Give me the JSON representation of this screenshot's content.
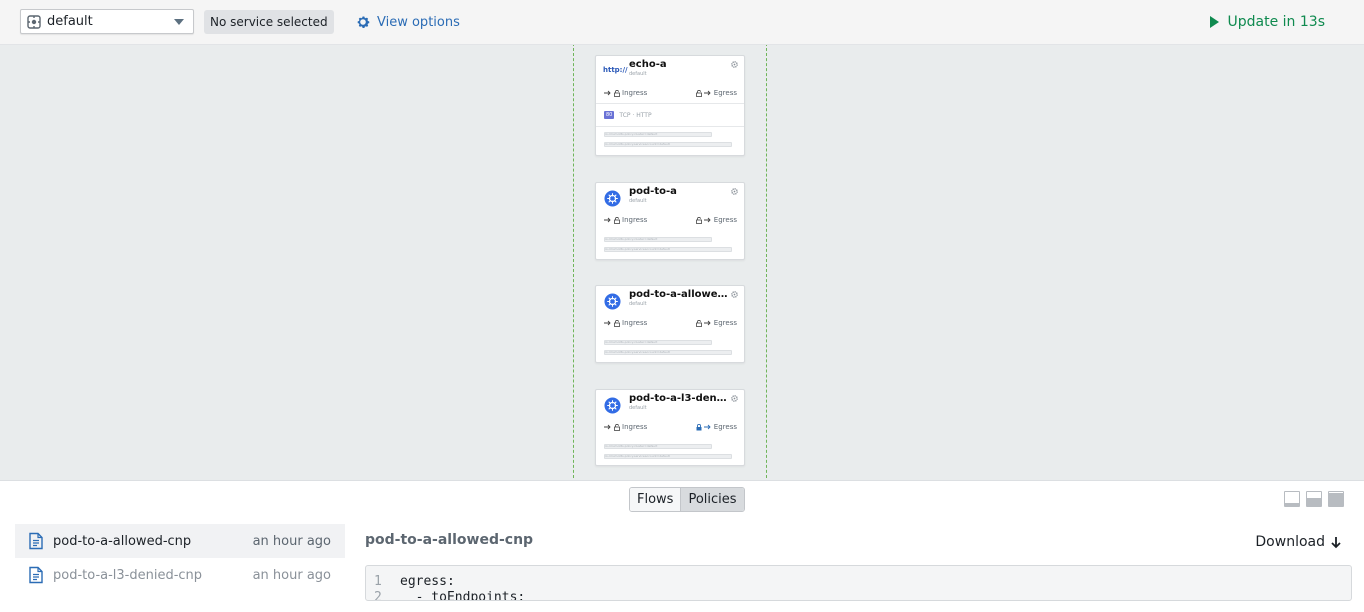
{
  "topbar": {
    "namespace": "default",
    "service_badge": "No service selected",
    "view_options": "View options",
    "update": "Update in 13s"
  },
  "map": {
    "cards": [
      {
        "title": "echo-a",
        "namespace": "default",
        "icon": "http-badge-icon",
        "icon_text": "http://",
        "ingress": "Ingress",
        "egress": "Egress",
        "egress_lock": "unlocked",
        "protocol_port": "80",
        "protocol": "TCP · HTTP",
        "labels": [
          "io.cilium.k8s.policy.cluster=default",
          "io.cilium.k8s.policy.serviceaccount=default"
        ]
      },
      {
        "title": "pod-to-a",
        "namespace": "default",
        "icon": "kubernetes-icon",
        "ingress": "Ingress",
        "egress": "Egress",
        "egress_lock": "unlocked",
        "labels": [
          "io.cilium.k8s.policy.cluster=default",
          "io.cilium.k8s.policy.serviceaccount=default"
        ]
      },
      {
        "title": "pod-to-a-allowed-…",
        "namespace": "default",
        "icon": "kubernetes-icon",
        "ingress": "Ingress",
        "egress": "Egress",
        "egress_lock": "unlocked",
        "labels": [
          "io.cilium.k8s.policy.cluster=default",
          "io.cilium.k8s.policy.serviceaccount=default"
        ]
      },
      {
        "title": "pod-to-a-l3-denie…",
        "namespace": "default",
        "icon": "kubernetes-icon",
        "ingress": "Ingress",
        "egress": "Egress",
        "egress_lock": "locked",
        "labels": [
          "io.cilium.k8s.policy.cluster=default",
          "io.cilium.k8s.policy.serviceaccount=default"
        ]
      }
    ]
  },
  "bottom": {
    "tabs": [
      {
        "label": "Flows",
        "active": false
      },
      {
        "label": "Policies",
        "active": true
      }
    ],
    "policies": [
      {
        "name": "pod-to-a-allowed-cnp",
        "time": "an hour ago",
        "selected": true
      },
      {
        "name": "pod-to-a-l3-denied-cnp",
        "time": "an hour ago",
        "selected": false
      }
    ],
    "selected_title": "pod-to-a-allowed-cnp",
    "download": "Download",
    "code": [
      {
        "ln": "1",
        "text": "egress:"
      },
      {
        "ln": "2",
        "text": "  - toEndpoints:"
      }
    ]
  },
  "colors": {
    "accent_blue": "#2b6cb5",
    "update_green": "#0f8a4f",
    "namespace_border": "#6fb55a",
    "kubernetes_blue": "#326ce5"
  }
}
